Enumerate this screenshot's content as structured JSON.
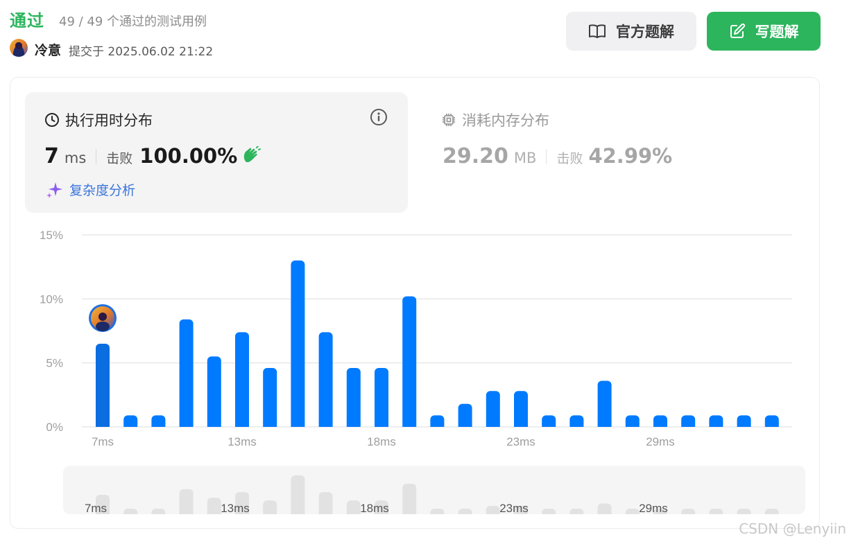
{
  "header": {
    "status": "通过",
    "testcases": "49 / 49 个通过的测试用例",
    "username": "冷意",
    "submitted": "提交于 2025.06.02 21:22",
    "official_solution_label": "官方题解",
    "write_solution_label": "写题解"
  },
  "runtime": {
    "title": "执行用时分布",
    "value": "7",
    "unit": "ms",
    "beat_label": "击败",
    "beat_pct": "100.00%",
    "complexity_label": "复杂度分析"
  },
  "memory": {
    "title": "消耗内存分布",
    "value": "29.20",
    "unit": "MB",
    "beat_label": "击败",
    "beat_pct": "42.99%"
  },
  "chart_data": {
    "type": "bar",
    "ylim": [
      0,
      15
    ],
    "y_ticks": [
      "0%",
      "5%",
      "10%",
      "15%"
    ],
    "y_tick_values": [
      0,
      5,
      10,
      15
    ],
    "values": [
      6.5,
      0.9,
      0.9,
      8.4,
      5.5,
      7.4,
      4.6,
      13.0,
      7.4,
      4.6,
      4.6,
      10.2,
      0.9,
      1.8,
      2.8,
      2.8,
      0.9,
      0.9,
      3.6,
      0.9,
      0.9,
      0.9,
      0.9,
      0.9,
      0.9
    ],
    "highlight_index": 0,
    "x_tick_labels": [
      {
        "index": 0,
        "label": "7ms"
      },
      {
        "index": 5,
        "label": "13ms"
      },
      {
        "index": 10,
        "label": "18ms"
      },
      {
        "index": 15,
        "label": "23ms"
      },
      {
        "index": 20,
        "label": "29ms"
      }
    ],
    "grid": true,
    "colors": {
      "bar": "#007aff",
      "highlight": "#0a6de0",
      "grid": "#e8e8e8",
      "tick": "#9e9e9e"
    }
  },
  "watermark": "CSDN @Lenyiin"
}
